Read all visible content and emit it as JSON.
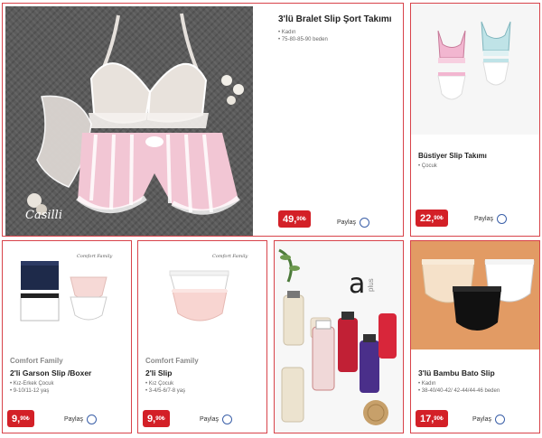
{
  "colors": {
    "accent": "#d32027",
    "border": "#d8434a",
    "share_circle": "#3a5fa8"
  },
  "share_label": "Paylaş",
  "featured": {
    "title": "3'lü Bralet Slip Şort Takımı",
    "meta": [
      "• Kadın",
      "• 75-80-85-90 beden"
    ],
    "price_main": "49,",
    "price_sup": "90₺",
    "brand_logo": "Casilli"
  },
  "products": [
    {
      "title": "Büstiyer Slip Takımı",
      "meta": [
        "• Çocuk"
      ],
      "price_main": "22,",
      "price_sup": "90₺"
    },
    {
      "brand": "Comfort Family",
      "title": "2'li Garson Slip /Boxer",
      "meta": [
        "• Kız-Erkek Çocuk",
        "• 9-10/11-12 yaş"
      ],
      "price_main": "9,",
      "price_sup": "90₺",
      "pack_label": "Comfort Family"
    },
    {
      "brand": "Comfort Family",
      "title": "2'li Slip",
      "meta": [
        "• Kız Çocuk",
        "• 3-4/5-6/7-8 yaş"
      ],
      "price_main": "9,",
      "price_sup": "90₺",
      "pack_label": "Comfort Family"
    },
    {
      "title": "3'lü Bambu Bato Slip",
      "meta": [
        "• Kadın",
        "• 38-40/40-42/ 42-44/44-46 beden"
      ],
      "price_main": "17,",
      "price_sup": "90₺"
    }
  ],
  "promo": {
    "logo_text": "a",
    "logo_word": "plus"
  }
}
